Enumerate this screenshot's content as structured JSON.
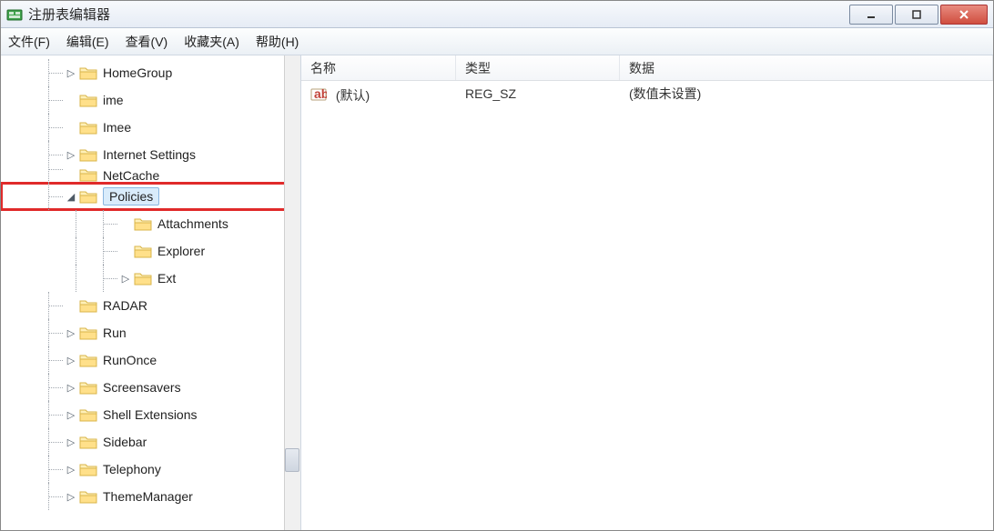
{
  "titlebar": {
    "title": "注册表编辑器"
  },
  "menu": {
    "file": "文件(F)",
    "edit": "编辑(E)",
    "view": "查看(V)",
    "favorites": "收藏夹(A)",
    "help": "帮助(H)"
  },
  "tree": {
    "nodes": [
      {
        "label": "HomeGroup",
        "expander": "▷",
        "depth": 1
      },
      {
        "label": "ime",
        "expander": "",
        "depth": 1
      },
      {
        "label": "Imee",
        "expander": "",
        "depth": 1
      },
      {
        "label": "Internet Settings",
        "expander": "▷",
        "depth": 1
      },
      {
        "label": "NetCache",
        "expander": "",
        "depth": 1,
        "clipped": true
      },
      {
        "label": "Policies",
        "expander": "◢",
        "depth": 1,
        "highlight": true
      },
      {
        "label": "Attachments",
        "expander": "",
        "depth": 2
      },
      {
        "label": "Explorer",
        "expander": "",
        "depth": 2
      },
      {
        "label": "Ext",
        "expander": "▷",
        "depth": 2
      },
      {
        "label": "RADAR",
        "expander": "",
        "depth": 1
      },
      {
        "label": "Run",
        "expander": "▷",
        "depth": 1
      },
      {
        "label": "RunOnce",
        "expander": "▷",
        "depth": 1
      },
      {
        "label": "Screensavers",
        "expander": "▷",
        "depth": 1
      },
      {
        "label": "Shell Extensions",
        "expander": "▷",
        "depth": 1
      },
      {
        "label": "Sidebar",
        "expander": "▷",
        "depth": 1
      },
      {
        "label": "Telephony",
        "expander": "▷",
        "depth": 1
      },
      {
        "label": "ThemeManager",
        "expander": "▷",
        "depth": 1
      }
    ]
  },
  "list": {
    "columns": {
      "name": "名称",
      "type": "类型",
      "data": "数据"
    },
    "rows": [
      {
        "name": "(默认)",
        "type": "REG_SZ",
        "data": "(数值未设置)"
      }
    ]
  }
}
